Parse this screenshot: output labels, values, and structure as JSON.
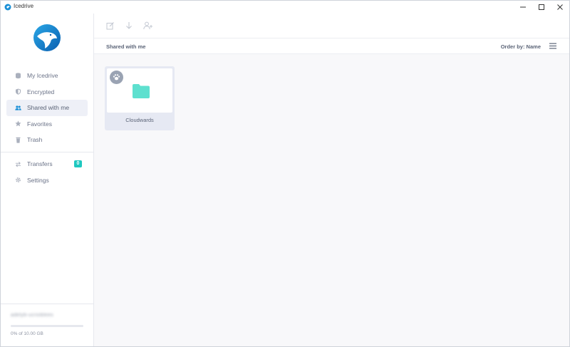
{
  "window": {
    "title": "Icedrive"
  },
  "sidebar": {
    "items": [
      {
        "label": "My Icedrive",
        "icon": "database-icon"
      },
      {
        "label": "Encrypted",
        "icon": "shield-icon"
      },
      {
        "label": "Shared with me",
        "icon": "users-icon",
        "active": true
      },
      {
        "label": "Favorites",
        "icon": "star-icon"
      },
      {
        "label": "Trash",
        "icon": "trash-icon"
      }
    ],
    "secondary": [
      {
        "label": "Transfers",
        "icon": "transfer-icon",
        "badge": "0"
      },
      {
        "label": "Settings",
        "icon": "gear-icon"
      }
    ],
    "storage": {
      "user": "adelyb-ucroiblees",
      "usage_text": "0% of 10.00 GB",
      "used_fraction": 0.0
    }
  },
  "toolbar": {
    "tools": [
      "edit-icon",
      "download-icon",
      "add-user-icon"
    ]
  },
  "subheader": {
    "crumb": "Shared with me",
    "order_by": "Order by: Name"
  },
  "files": [
    {
      "name": "Cloudwards",
      "type": "folder"
    }
  ],
  "colors": {
    "accent": "#1fc8c0",
    "folder": "#5ee0cf",
    "active_bg": "#eef0f7"
  }
}
